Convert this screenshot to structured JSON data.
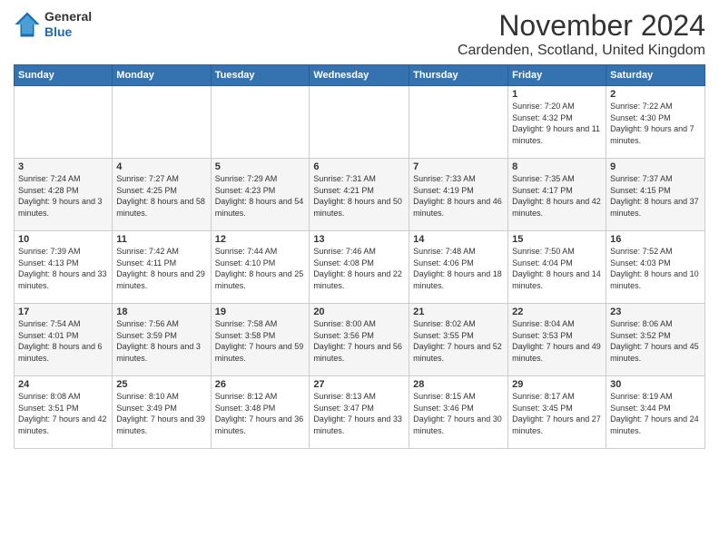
{
  "logo": {
    "general": "General",
    "blue": "Blue"
  },
  "title": "November 2024",
  "location": "Cardenden, Scotland, United Kingdom",
  "days_of_week": [
    "Sunday",
    "Monday",
    "Tuesday",
    "Wednesday",
    "Thursday",
    "Friday",
    "Saturday"
  ],
  "weeks": [
    [
      {
        "day": "",
        "sunrise": "",
        "sunset": "",
        "daylight": ""
      },
      {
        "day": "",
        "sunrise": "",
        "sunset": "",
        "daylight": ""
      },
      {
        "day": "",
        "sunrise": "",
        "sunset": "",
        "daylight": ""
      },
      {
        "day": "",
        "sunrise": "",
        "sunset": "",
        "daylight": ""
      },
      {
        "day": "",
        "sunrise": "",
        "sunset": "",
        "daylight": ""
      },
      {
        "day": "1",
        "sunrise": "Sunrise: 7:20 AM",
        "sunset": "Sunset: 4:32 PM",
        "daylight": "Daylight: 9 hours and 11 minutes."
      },
      {
        "day": "2",
        "sunrise": "Sunrise: 7:22 AM",
        "sunset": "Sunset: 4:30 PM",
        "daylight": "Daylight: 9 hours and 7 minutes."
      }
    ],
    [
      {
        "day": "3",
        "sunrise": "Sunrise: 7:24 AM",
        "sunset": "Sunset: 4:28 PM",
        "daylight": "Daylight: 9 hours and 3 minutes."
      },
      {
        "day": "4",
        "sunrise": "Sunrise: 7:27 AM",
        "sunset": "Sunset: 4:25 PM",
        "daylight": "Daylight: 8 hours and 58 minutes."
      },
      {
        "day": "5",
        "sunrise": "Sunrise: 7:29 AM",
        "sunset": "Sunset: 4:23 PM",
        "daylight": "Daylight: 8 hours and 54 minutes."
      },
      {
        "day": "6",
        "sunrise": "Sunrise: 7:31 AM",
        "sunset": "Sunset: 4:21 PM",
        "daylight": "Daylight: 8 hours and 50 minutes."
      },
      {
        "day": "7",
        "sunrise": "Sunrise: 7:33 AM",
        "sunset": "Sunset: 4:19 PM",
        "daylight": "Daylight: 8 hours and 46 minutes."
      },
      {
        "day": "8",
        "sunrise": "Sunrise: 7:35 AM",
        "sunset": "Sunset: 4:17 PM",
        "daylight": "Daylight: 8 hours and 42 minutes."
      },
      {
        "day": "9",
        "sunrise": "Sunrise: 7:37 AM",
        "sunset": "Sunset: 4:15 PM",
        "daylight": "Daylight: 8 hours and 37 minutes."
      }
    ],
    [
      {
        "day": "10",
        "sunrise": "Sunrise: 7:39 AM",
        "sunset": "Sunset: 4:13 PM",
        "daylight": "Daylight: 8 hours and 33 minutes."
      },
      {
        "day": "11",
        "sunrise": "Sunrise: 7:42 AM",
        "sunset": "Sunset: 4:11 PM",
        "daylight": "Daylight: 8 hours and 29 minutes."
      },
      {
        "day": "12",
        "sunrise": "Sunrise: 7:44 AM",
        "sunset": "Sunset: 4:10 PM",
        "daylight": "Daylight: 8 hours and 25 minutes."
      },
      {
        "day": "13",
        "sunrise": "Sunrise: 7:46 AM",
        "sunset": "Sunset: 4:08 PM",
        "daylight": "Daylight: 8 hours and 22 minutes."
      },
      {
        "day": "14",
        "sunrise": "Sunrise: 7:48 AM",
        "sunset": "Sunset: 4:06 PM",
        "daylight": "Daylight: 8 hours and 18 minutes."
      },
      {
        "day": "15",
        "sunrise": "Sunrise: 7:50 AM",
        "sunset": "Sunset: 4:04 PM",
        "daylight": "Daylight: 8 hours and 14 minutes."
      },
      {
        "day": "16",
        "sunrise": "Sunrise: 7:52 AM",
        "sunset": "Sunset: 4:03 PM",
        "daylight": "Daylight: 8 hours and 10 minutes."
      }
    ],
    [
      {
        "day": "17",
        "sunrise": "Sunrise: 7:54 AM",
        "sunset": "Sunset: 4:01 PM",
        "daylight": "Daylight: 8 hours and 6 minutes."
      },
      {
        "day": "18",
        "sunrise": "Sunrise: 7:56 AM",
        "sunset": "Sunset: 3:59 PM",
        "daylight": "Daylight: 8 hours and 3 minutes."
      },
      {
        "day": "19",
        "sunrise": "Sunrise: 7:58 AM",
        "sunset": "Sunset: 3:58 PM",
        "daylight": "Daylight: 7 hours and 59 minutes."
      },
      {
        "day": "20",
        "sunrise": "Sunrise: 8:00 AM",
        "sunset": "Sunset: 3:56 PM",
        "daylight": "Daylight: 7 hours and 56 minutes."
      },
      {
        "day": "21",
        "sunrise": "Sunrise: 8:02 AM",
        "sunset": "Sunset: 3:55 PM",
        "daylight": "Daylight: 7 hours and 52 minutes."
      },
      {
        "day": "22",
        "sunrise": "Sunrise: 8:04 AM",
        "sunset": "Sunset: 3:53 PM",
        "daylight": "Daylight: 7 hours and 49 minutes."
      },
      {
        "day": "23",
        "sunrise": "Sunrise: 8:06 AM",
        "sunset": "Sunset: 3:52 PM",
        "daylight": "Daylight: 7 hours and 45 minutes."
      }
    ],
    [
      {
        "day": "24",
        "sunrise": "Sunrise: 8:08 AM",
        "sunset": "Sunset: 3:51 PM",
        "daylight": "Daylight: 7 hours and 42 minutes."
      },
      {
        "day": "25",
        "sunrise": "Sunrise: 8:10 AM",
        "sunset": "Sunset: 3:49 PM",
        "daylight": "Daylight: 7 hours and 39 minutes."
      },
      {
        "day": "26",
        "sunrise": "Sunrise: 8:12 AM",
        "sunset": "Sunset: 3:48 PM",
        "daylight": "Daylight: 7 hours and 36 minutes."
      },
      {
        "day": "27",
        "sunrise": "Sunrise: 8:13 AM",
        "sunset": "Sunset: 3:47 PM",
        "daylight": "Daylight: 7 hours and 33 minutes."
      },
      {
        "day": "28",
        "sunrise": "Sunrise: 8:15 AM",
        "sunset": "Sunset: 3:46 PM",
        "daylight": "Daylight: 7 hours and 30 minutes."
      },
      {
        "day": "29",
        "sunrise": "Sunrise: 8:17 AM",
        "sunset": "Sunset: 3:45 PM",
        "daylight": "Daylight: 7 hours and 27 minutes."
      },
      {
        "day": "30",
        "sunrise": "Sunrise: 8:19 AM",
        "sunset": "Sunset: 3:44 PM",
        "daylight": "Daylight: 7 hours and 24 minutes."
      }
    ]
  ]
}
